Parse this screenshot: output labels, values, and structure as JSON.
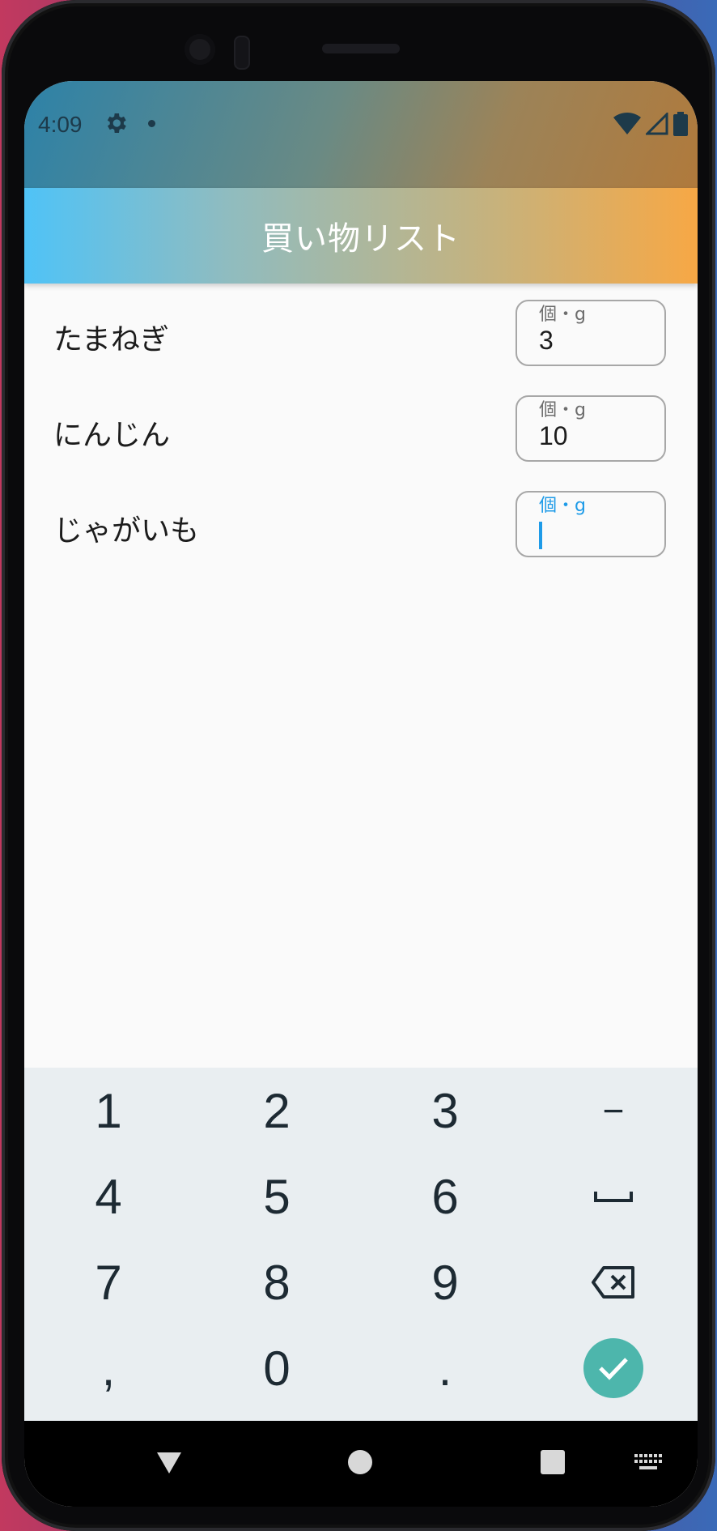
{
  "status_bar": {
    "time": "4:09",
    "icons": [
      "gear-icon",
      "notification-dot-icon",
      "wifi-icon",
      "cell-signal-icon",
      "battery-icon"
    ]
  },
  "app_bar": {
    "title": "買い物リスト"
  },
  "items": [
    {
      "name": "たまねぎ",
      "field_label": "個・g",
      "value": "3",
      "focused": false
    },
    {
      "name": "にんじん",
      "field_label": "個・g",
      "value": "10",
      "focused": false
    },
    {
      "name": "じゃがいも",
      "field_label": "個・g",
      "value": "",
      "focused": true
    }
  ],
  "keyboard": {
    "rows": [
      [
        "1",
        "2",
        "3",
        "−"
      ],
      [
        "4",
        "5",
        "6",
        "space"
      ],
      [
        "7",
        "8",
        "9",
        "backspace"
      ],
      [
        ",",
        "0",
        ".",
        "done"
      ]
    ],
    "labels": {
      "k1": "1",
      "k2": "2",
      "k3": "3",
      "minus": "−",
      "k4": "4",
      "k5": "5",
      "k6": "6",
      "k7": "7",
      "k8": "8",
      "k9": "9",
      "comma": ",",
      "k0": "0",
      "period": "."
    }
  },
  "nav_bar": {
    "icons": [
      "back-icon",
      "home-icon",
      "recents-icon",
      "keyboard-switch-icon"
    ]
  },
  "colors": {
    "accent": "#1e9be8",
    "done_button": "#4db6ac",
    "keyboard_bg": "#e9eef1"
  }
}
